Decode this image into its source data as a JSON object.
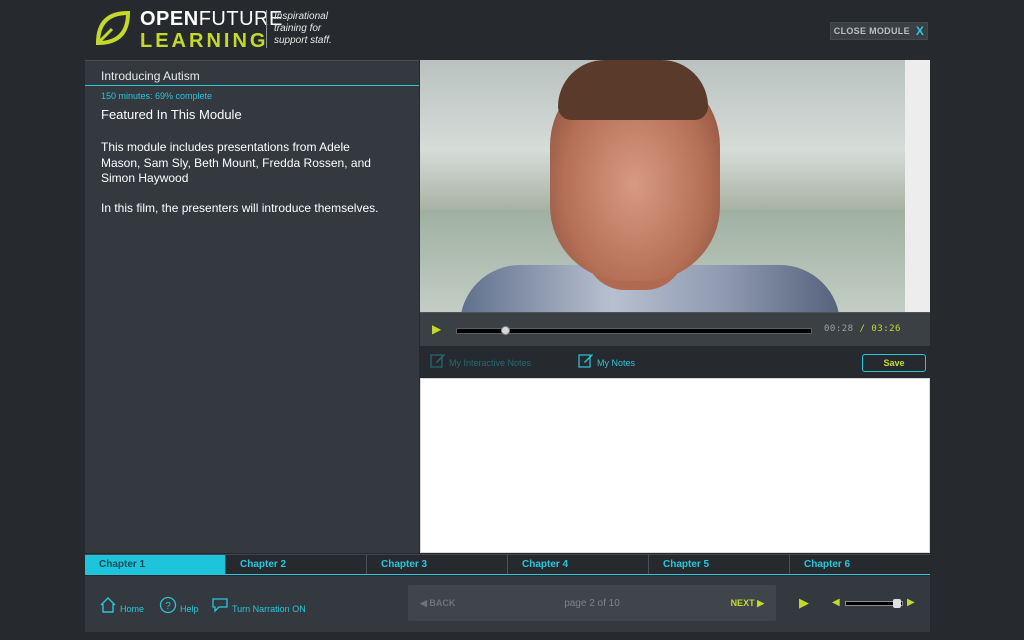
{
  "brand": {
    "word_open": "OPEN",
    "word_future": "FUTURE",
    "word_learning": "LEARNING",
    "tagline_lines": [
      "Inspirational",
      "training for",
      "support staff."
    ]
  },
  "header": {
    "close_label": "CLOSE MODULE",
    "close_icon": "X"
  },
  "module": {
    "title": "Introducing Autism",
    "progress_text": "150 minutes: 69% complete",
    "featured_heading": "Featured In This Module",
    "description_lines": [
      "This module includes presentations from Adele",
      "Mason, Sam Sly, Beth Mount, Fredda Rossen, and",
      "Simon Haywood"
    ],
    "description_2": "In this film, the presenters will introduce themselves."
  },
  "video": {
    "current_time": "00:28",
    "separator": "/",
    "total_time": "03:26",
    "progress_fraction": 0.136
  },
  "notes": {
    "tab_interactive": "My Interactive Notes",
    "tab_mynotes": "My Notes",
    "save_label": "Save"
  },
  "chapters": [
    {
      "label": "Chapter 1",
      "active": true
    },
    {
      "label": "Chapter 2",
      "active": false
    },
    {
      "label": "Chapter 3",
      "active": false
    },
    {
      "label": "Chapter 4",
      "active": false
    },
    {
      "label": "Chapter 5",
      "active": false
    },
    {
      "label": "Chapter 6",
      "active": false
    }
  ],
  "footer": {
    "home_label": "Home",
    "help_label": "Help",
    "narration_label": "Turn Narration ON",
    "back_label": "BACK",
    "page_indicator": "page 2 of 10",
    "next_label": "NEXT",
    "volume_fraction": 0.95
  },
  "colors": {
    "accent_cyan": "#29c6dc",
    "accent_lime": "#c5d92b",
    "background": "#262a2e",
    "panel": "#33393e"
  }
}
